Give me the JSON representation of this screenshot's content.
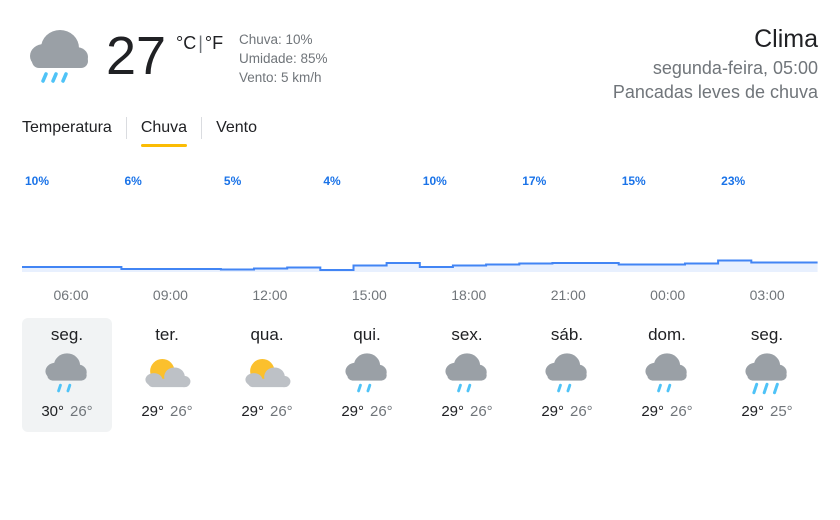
{
  "current": {
    "icon": "rain-cloud-icon",
    "temperature": "27",
    "unit_c": "°C",
    "unit_sep": "|",
    "unit_f": "°F",
    "precipitation": "Chuva: 10%",
    "humidity": "Umidade: 85%",
    "wind": "Vento: 5 km/h"
  },
  "location": {
    "title": "Clima",
    "datetime": "segunda-feira, 05:00",
    "condition": "Pancadas leves de chuva"
  },
  "tabs": [
    {
      "label": "Temperatura",
      "active": false
    },
    {
      "label": "Chuva",
      "active": true
    },
    {
      "label": "Vento",
      "active": false
    }
  ],
  "colors": {
    "accent": "#fbbc04",
    "rain_label": "#1a73e8",
    "chart_line": "#4285f4",
    "chart_fill": "#e8f0fe",
    "selected_day_bg": "#f1f3f4"
  },
  "chart_data": {
    "type": "area",
    "x": [
      "06:00",
      "07:00",
      "08:00",
      "09:00",
      "10:00",
      "11:00",
      "12:00",
      "13:00",
      "14:00",
      "15:00",
      "16:00",
      "17:00",
      "18:00",
      "19:00",
      "20:00",
      "21:00",
      "22:00",
      "23:00",
      "00:00",
      "01:00",
      "02:00",
      "03:00",
      "04:00",
      "05:00"
    ],
    "y": [
      10,
      10,
      10,
      6,
      6,
      6,
      5,
      7,
      9,
      4,
      13,
      18,
      10,
      13,
      15,
      17,
      18,
      18,
      15,
      15,
      17,
      23,
      19,
      19
    ],
    "unit": "%",
    "value_labels": [
      "10%",
      "6%",
      "5%",
      "4%",
      "10%",
      "17%",
      "15%",
      "23%"
    ],
    "tick_labels": [
      "06:00",
      "09:00",
      "12:00",
      "15:00",
      "18:00",
      "21:00",
      "00:00",
      "03:00"
    ],
    "ylim": [
      0,
      100
    ]
  },
  "days": [
    {
      "name": "seg.",
      "icon": "rain-cloud-icon",
      "hi": "30°",
      "lo": "26°",
      "selected": true
    },
    {
      "name": "ter.",
      "icon": "partly-cloudy-icon",
      "hi": "29°",
      "lo": "26°",
      "selected": false
    },
    {
      "name": "qua.",
      "icon": "partly-cloudy-icon",
      "hi": "29°",
      "lo": "26°",
      "selected": false
    },
    {
      "name": "qui.",
      "icon": "rain-cloud-icon",
      "hi": "29°",
      "lo": "26°",
      "selected": false
    },
    {
      "name": "sex.",
      "icon": "rain-cloud-icon",
      "hi": "29°",
      "lo": "26°",
      "selected": false
    },
    {
      "name": "sáb.",
      "icon": "rain-cloud-icon",
      "hi": "29°",
      "lo": "26°",
      "selected": false
    },
    {
      "name": "dom.",
      "icon": "rain-cloud-icon",
      "hi": "29°",
      "lo": "26°",
      "selected": false
    },
    {
      "name": "seg.",
      "icon": "heavy-rain-cloud-icon",
      "hi": "29°",
      "lo": "25°",
      "selected": false
    }
  ]
}
